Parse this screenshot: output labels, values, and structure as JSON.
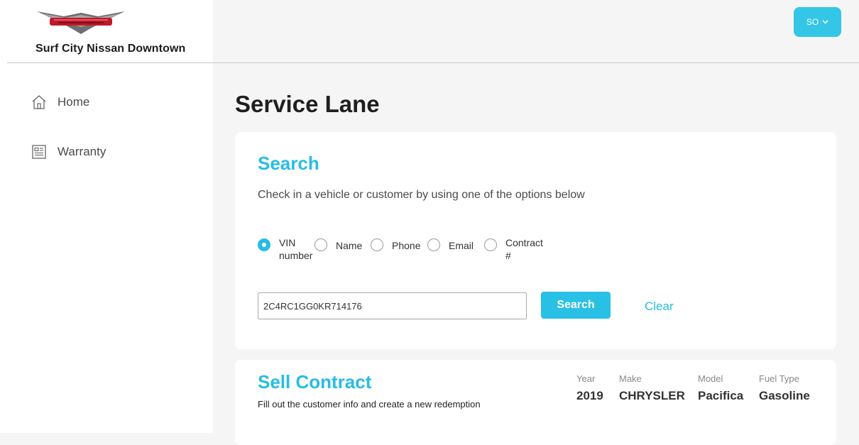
{
  "header": {
    "dealer_name": "Surf City Nissan Downtown",
    "user_initials": "SO"
  },
  "sidebar": {
    "items": [
      {
        "label": "Home",
        "icon": "home-icon"
      },
      {
        "label": "Warranty",
        "icon": "document-icon"
      }
    ]
  },
  "main": {
    "title": "Service Lane",
    "search": {
      "heading": "Search",
      "description": "Check in a vehicle or customer by using one of the options below",
      "options": [
        {
          "line1": "VIN",
          "line2": "number",
          "checked": true
        },
        {
          "line1": "Name",
          "line2": "",
          "checked": false
        },
        {
          "line1": "Phone",
          "line2": "",
          "checked": false
        },
        {
          "line1": "Email",
          "line2": "",
          "checked": false
        },
        {
          "line1": "Contract",
          "line2": "#",
          "checked": false
        }
      ],
      "input_value": "2C4RC1GG0KR714176",
      "search_button": "Search",
      "clear_link": "Clear"
    },
    "sell_contract": {
      "heading": "Sell Contract",
      "description": "Fill out the customer info and create a new redemption",
      "specs": [
        {
          "label": "Year",
          "value": "2019"
        },
        {
          "label": "Make",
          "value": "CHRYSLER"
        },
        {
          "label": "Model",
          "value": "Pacifica"
        },
        {
          "label": "Fuel Type",
          "value": "Gasoline"
        }
      ]
    }
  },
  "colors": {
    "accent": "#27bde3",
    "page_bg": "#f5f5f5",
    "card_bg": "#ffffff"
  }
}
